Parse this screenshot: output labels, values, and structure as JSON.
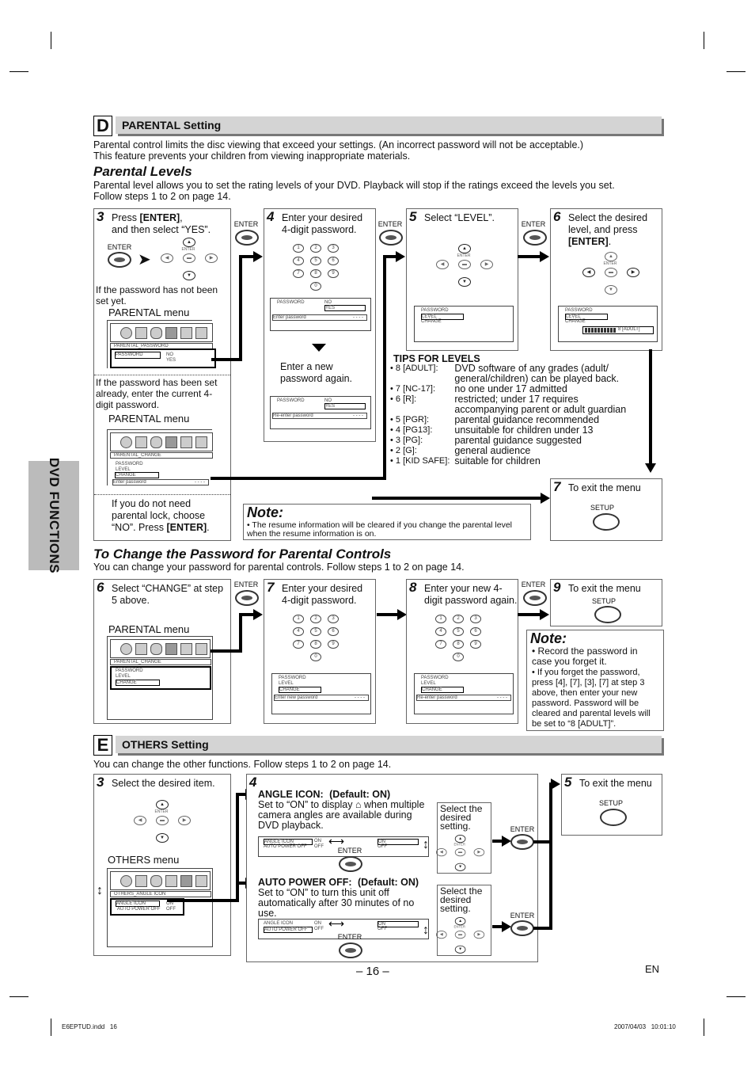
{
  "section_d": {
    "letter": "D",
    "title": "PARENTAL Setting",
    "intro_line1": "Parental control limits the disc viewing that exceed your settings. (An incorrect password will not be acceptable.)",
    "intro_line2": "This feature prevents your children from viewing inappropriate materials.",
    "levels_heading": "Parental Levels",
    "levels_line1": "Parental level allows you to set the rating levels of your DVD. Playback will stop if the ratings exceed the levels you set.",
    "levels_line2": "Follow steps 1 to 2 on page 14.",
    "enter_label": "ENTER",
    "setup_label": "SETUP",
    "step3": {
      "num": "3",
      "text_a": "Press ",
      "text_b": "[ENTER]",
      "text_c": ",",
      "text_d": "and then select “YES”.",
      "not_set": "If the password has not been set yet.",
      "menu_label": "PARENTAL menu",
      "screen1_title": "PARENTAL_PASSWORD",
      "screen1_item": "PASSWORD",
      "screen1_no": "NO",
      "screen1_yes": "YES",
      "already_set": "If the password has been set already, enter the current 4-digit password.",
      "screen2_title": "PARENTAL_CHANGE",
      "screen2_items": [
        "PASSWORD",
        "LEVEL",
        "CHANGE"
      ],
      "screen2_prompt": "Enter password",
      "screen2_mask": "- - - -",
      "no_need_a": "If you do not need parental lock, choose “NO”. Press ",
      "no_need_b": "[ENTER]",
      "no_need_c": "."
    },
    "step4": {
      "num": "4",
      "text": "Enter your desired 4-digit password.",
      "keys": [
        "1",
        "2",
        "3",
        "4",
        "5",
        "6",
        "7",
        "8",
        "9",
        "0"
      ],
      "screen_item": "PASSWORD",
      "screen_no": "NO",
      "screen_yes": "YES",
      "prompt1": "Enter password",
      "mask": "- - - -",
      "again": "Enter a new password again.",
      "prompt2": "Re-enter password"
    },
    "step5": {
      "num": "5",
      "text": "Select “LEVEL”.",
      "items": [
        "PASSWORD",
        "LEVEL",
        "CHANGE"
      ]
    },
    "step6": {
      "num": "6",
      "text_a": "Select the desired level, and press ",
      "text_b": "[ENTER]",
      "text_c": ".",
      "items": [
        "PASSWORD",
        "LEVEL",
        "CHANGE"
      ],
      "level_value": "8 [ADULT]",
      "level_fraction": 1.0
    },
    "tips": {
      "title": "TIPS FOR LEVELS",
      "rows": [
        {
          "key": "• 8 [ADULT]:",
          "desc": "DVD software of any grades (adult/ general/children) can be played back."
        },
        {
          "key": "• 7 [NC-17]:",
          "desc": "no one under 17 admitted"
        },
        {
          "key": "• 6 [R]:",
          "desc": "restricted; under 17 requires accompanying parent or adult guardian"
        },
        {
          "key": "• 5 [PGR]:",
          "desc": "parental guidance recommended"
        },
        {
          "key": "• 4 [PG13]:",
          "desc": "unsuitable for children under 13"
        },
        {
          "key": "• 3 [PG]:",
          "desc": "parental guidance suggested"
        },
        {
          "key": "• 2 [G]:",
          "desc": "general audience"
        },
        {
          "key": "• 1 [KID SAFE]:",
          "desc": "suitable for children"
        }
      ]
    },
    "step7": {
      "num": "7",
      "text": "To exit the menu"
    },
    "note": {
      "title": "Note:",
      "text": "• The resume information will be cleared if you change the parental level when the resume information is on."
    }
  },
  "change_password": {
    "heading": "To Change the Password for Parental Controls",
    "intro": "You can change your password for parental controls. Follow steps 1 to 2 on page 14.",
    "step6": {
      "num": "6",
      "text": "Select “CHANGE” at step 5 above.",
      "menu_label": "PARENTAL menu",
      "screen_title": "PARENTAL_CHANGE",
      "items": [
        "PASSWORD",
        "LEVEL",
        "CHANGE"
      ]
    },
    "step7": {
      "num": "7",
      "text": "Enter your desired 4-digit password.",
      "items": [
        "PASSWORD",
        "LEVEL",
        "CHANGE"
      ],
      "prompt": "Enter new password",
      "mask": "- - - -"
    },
    "step8": {
      "num": "8",
      "text": "Enter your new 4-digit password again.",
      "items": [
        "PASSWORD",
        "LEVEL",
        "CHANGE"
      ],
      "prompt": "Re-enter password",
      "mask": "- - - -"
    },
    "step9": {
      "num": "9",
      "text": "To exit the menu"
    },
    "note": {
      "title": "Note:",
      "bullet1": "• Record the password in case you forget it.",
      "bullet2": "• If you forget the password, press [4], [7], [3], [7] at step 3 above, then enter your new password. Password will be cleared and parental levels will be set to “8 [ADULT]”."
    }
  },
  "section_e": {
    "letter": "E",
    "title": "OTHERS Setting",
    "intro": "You can change the other functions. Follow steps 1 to 2 on page 14.",
    "step3": {
      "num": "3",
      "text": "Select the desired item.",
      "menu_label": "OTHERS menu",
      "screen_title": "OTHERS_ANGLE ICON",
      "rows": [
        {
          "item": "ANGLE ICON",
          "value": "ON"
        },
        {
          "item": "AUTO POWER OFF",
          "value": "OFF"
        }
      ]
    },
    "step4": {
      "num": "4",
      "angle_title": "ANGLE ICON:",
      "angle_default": "(Default: ON)",
      "angle_desc": "Set to “ON” to display ⌂ when multiple camera angles are available during DVD playback.",
      "power_title": "AUTO POWER OFF:",
      "power_default": "(Default: ON)",
      "power_desc": "Set to “ON” to turn this unit off automatically after 30 minutes of no use.",
      "select_text": "Select the desired setting.",
      "rows": [
        {
          "item": "ANGLE ICON",
          "value": "ON"
        },
        {
          "item": "AUTO POWER OFF",
          "value": "OFF"
        }
      ],
      "options": [
        "ON",
        "OFF"
      ]
    },
    "step5": {
      "num": "5",
      "text": "To exit the menu"
    }
  },
  "sidebar": {
    "label": "DVD FUNCTIONS"
  },
  "footer": {
    "page_number": "– 16 –",
    "lang": "EN",
    "file": "E6EPTUD.indd   16",
    "timestamp": "2007/04/03   10:01:10"
  }
}
